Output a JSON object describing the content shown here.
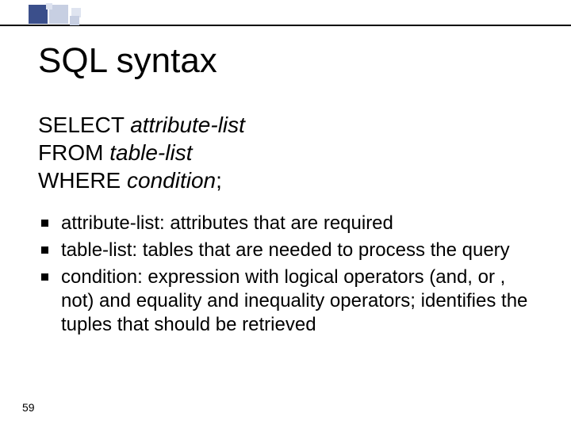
{
  "title": "SQL syntax",
  "syntax": {
    "select_kw": "SELECT",
    "select_arg": "attribute-list",
    "from_kw": "FROM",
    "from_arg": "table-list",
    "where_kw": "WHERE",
    "where_arg": "condition",
    "terminator": ";"
  },
  "bullets": [
    "attribute-list: attributes that are required",
    "table-list: tables that are needed to process the query",
    "condition: expression with logical operators (and, or , not) and equality and inequality operators; identifies the tuples that should be retrieved"
  ],
  "page_number": "59"
}
